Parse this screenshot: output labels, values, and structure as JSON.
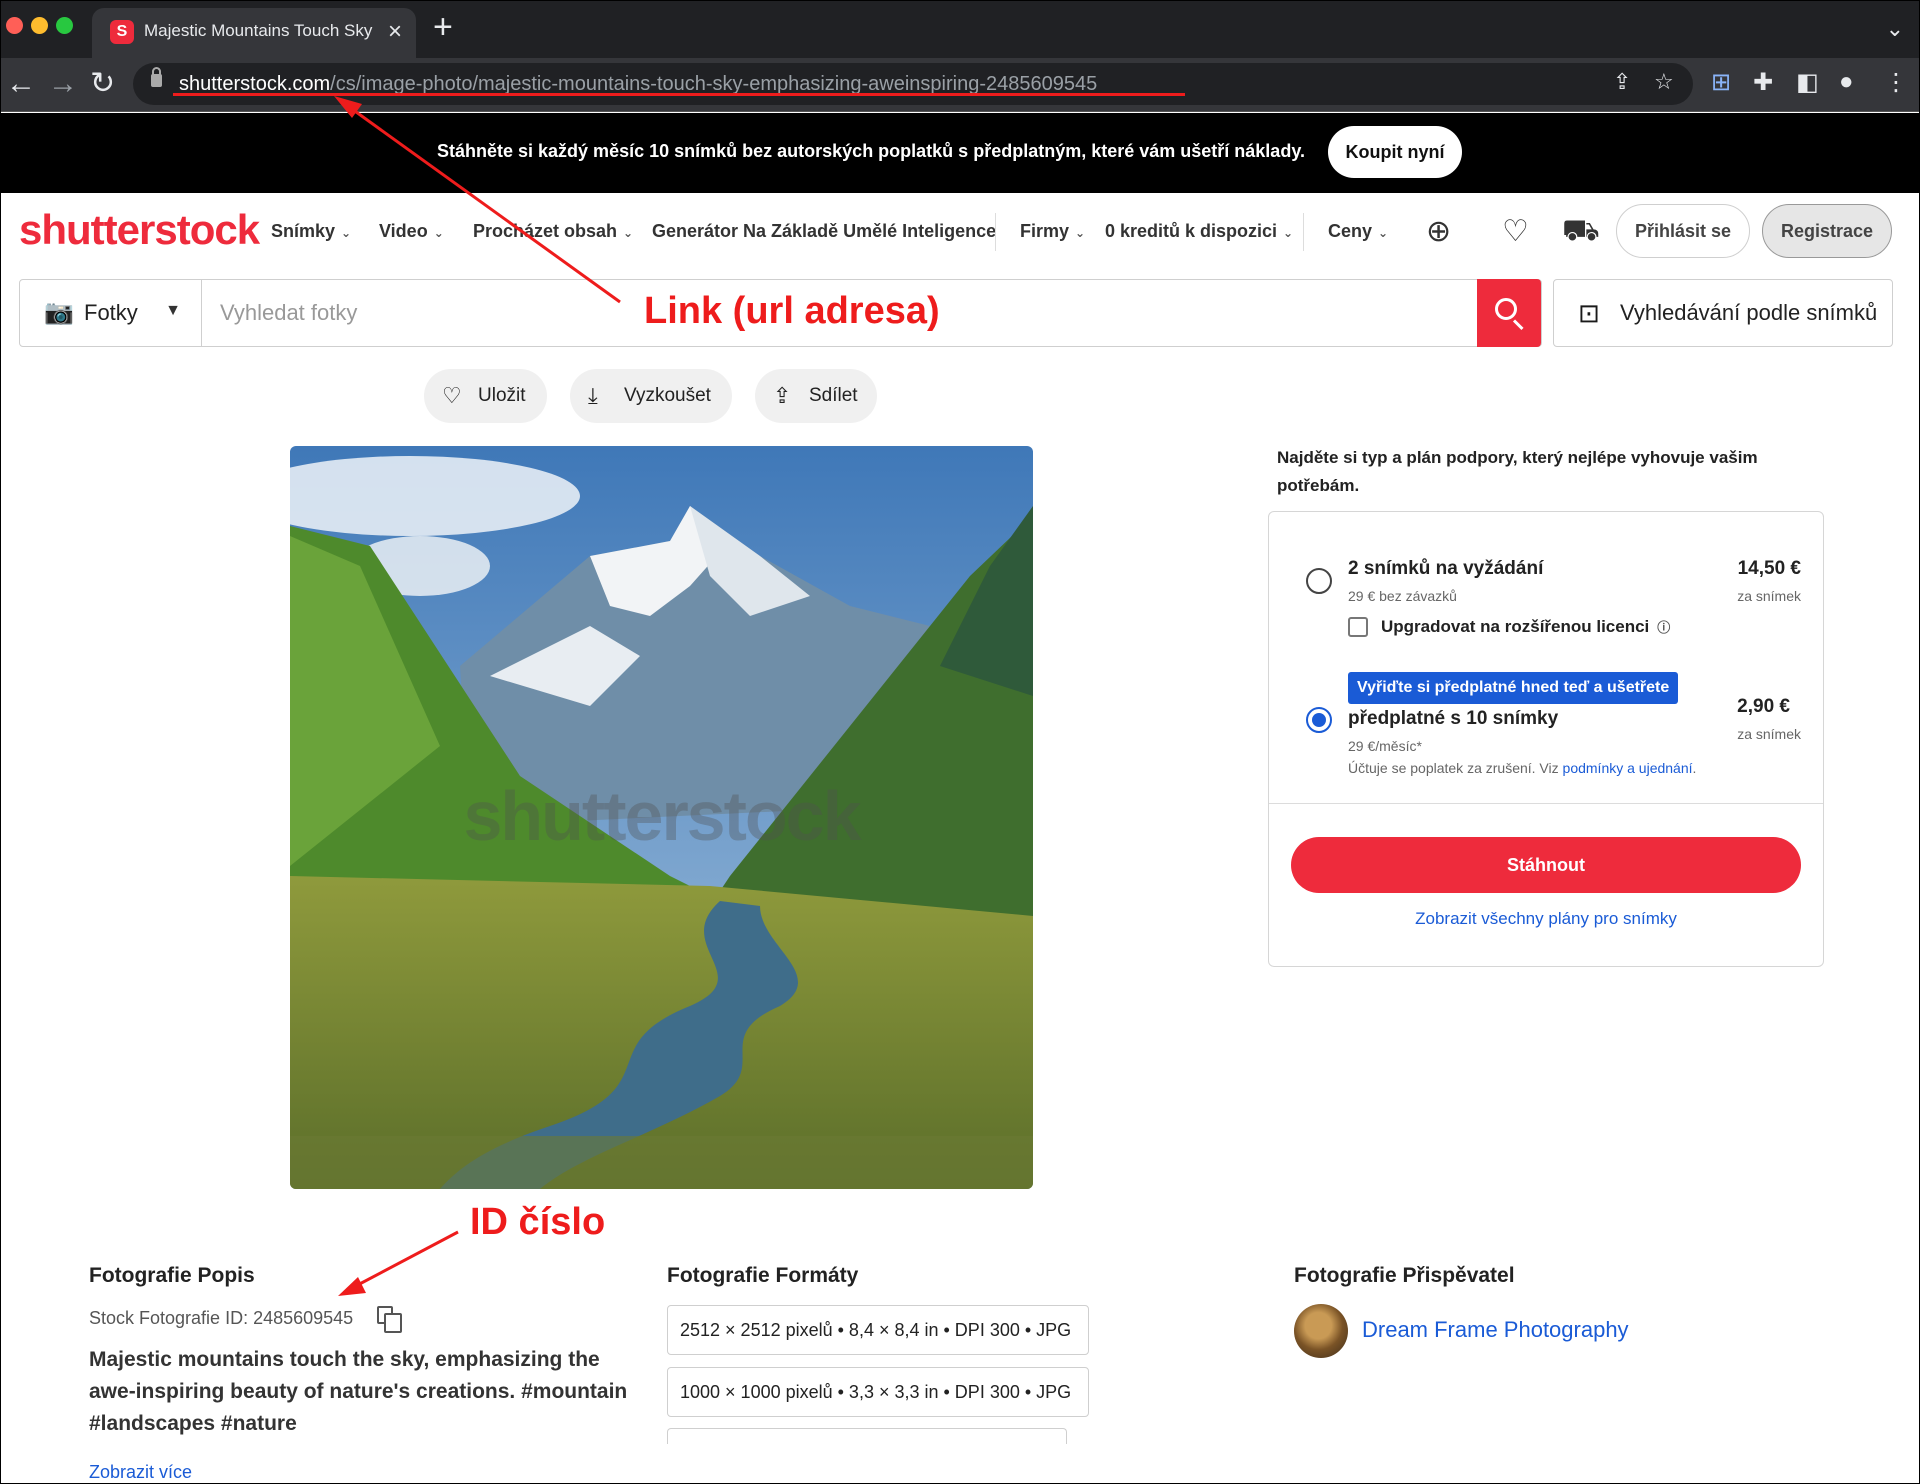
{
  "browser": {
    "tab_title": "Majestic Mountains Touch Sky",
    "tab_favicon": "shutterstock-favicon",
    "url_host": "shutterstock.com",
    "url_path": "/cs/image-photo/majestic-mountains-touch-sky-emphasizing-aweinspiring-2485609545"
  },
  "promo": {
    "text": "Stáhněte si každý měsíc 10 snímků bez autorských poplatků s předplatným, které vám ušetří náklady.",
    "button": "Koupit nyní"
  },
  "header": {
    "logo": "shutterstock",
    "nav": [
      "Snímky",
      "Video",
      "Procházet obsah",
      "Generátor Na Základě Umělé Inteligence",
      "Firmy",
      "0 kreditů k dispozici",
      "Ceny"
    ],
    "login": "Přihlásit se",
    "register": "Registrace"
  },
  "search": {
    "type": "Fotky",
    "placeholder": "Vyhledat fotky",
    "image_search": "Vyhledávání podle snímků"
  },
  "actions": {
    "save": "Uložit",
    "try": "Vyzkoušet",
    "share": "Sdílet"
  },
  "photo": {
    "watermark": "shutterstock"
  },
  "annotations": {
    "link_label": "Link (url adresa)",
    "id_label": "ID číslo",
    "color": "#ee1c1c"
  },
  "purchase": {
    "intro": "Najděte si typ a plán podpory, který nejlépe vyhovuje vašim potřebám.",
    "plan1": {
      "title": "2 snímků na vyžádání",
      "sub": "29 € bez závazků",
      "price": "14,50 €",
      "unit": "za snímek",
      "upgrade": "Upgradovat na rozšířenou licenci",
      "selected": false
    },
    "plan2": {
      "badge": "Vyřiďte si předplatné hned teď a ušetřete",
      "title": "předplatné s 10 snímky",
      "sub": "29 €/měsíc*",
      "note_prefix": "Účtuje se poplatek za zrušení. Viz ",
      "note_link": "podmínky a ujednání",
      "note_suffix": ".",
      "price": "2,90 €",
      "unit": "za snímek",
      "selected": true
    },
    "download": "Stáhnout",
    "all_plans": "Zobrazit všechny plány pro snímky"
  },
  "details": {
    "description_title": "Fotografie Popis",
    "stock_id": "Stock Fotografie ID: 2485609545",
    "description": "Majestic mountains touch the sky, emphasizing the awe-inspiring beauty of nature's creations. #mountain #landscapes #nature",
    "show_more": "Zobrazit více",
    "formats_title": "Fotografie Formáty",
    "formats": [
      "2512 × 2512 pixelů • 8,4 × 8,4 in • DPI 300 • JPG",
      "1000 × 1000 pixelů • 3,3 × 3,3 in • DPI 300 • JPG"
    ],
    "contributor_title": "Fotografie Přispěvatel",
    "contributor": "Dream Frame Photography"
  },
  "colors": {
    "brand": "#ee2b3c",
    "link": "#1a5bd6",
    "promo_bg": "#000000"
  }
}
